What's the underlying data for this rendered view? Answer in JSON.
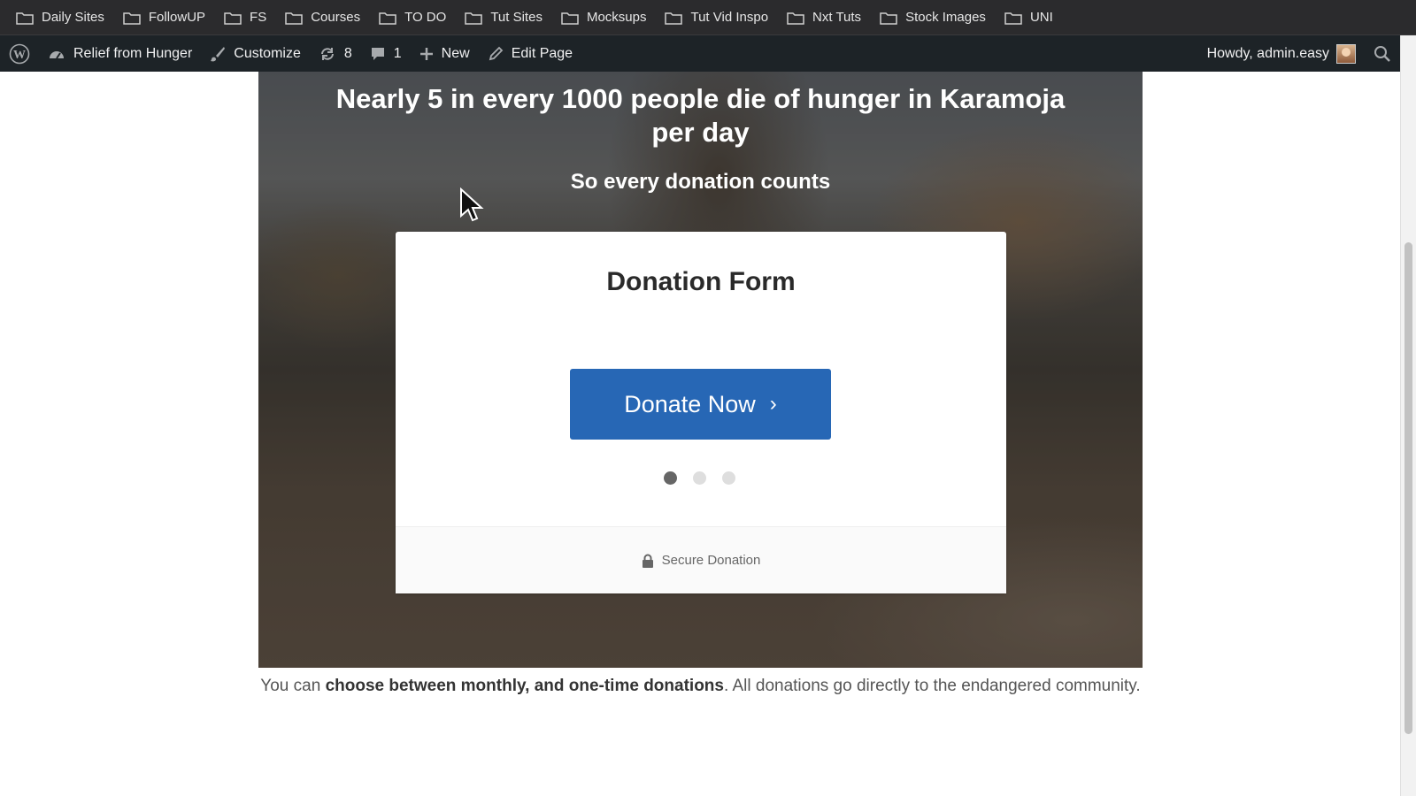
{
  "bookmarks": [
    "Daily Sites",
    "FollowUP",
    "FS",
    "Courses",
    "TO DO",
    "Tut Sites",
    "Mocksups",
    "Tut Vid Inspo",
    "Nxt Tuts",
    "Stock Images",
    "UNI"
  ],
  "adminbar": {
    "site_name": "Relief from Hunger",
    "customize": "Customize",
    "updates_count": "8",
    "comments_count": "1",
    "new_label": "New",
    "edit_label": "Edit Page",
    "howdy": "Howdy, admin.easy"
  },
  "hero": {
    "title": "Nearly 5 in every 1000 people die of hunger in Karamoja per day",
    "subtitle": "So every donation counts"
  },
  "form": {
    "title": "Donation Form",
    "button_label": "Donate Now",
    "button_chevron": "›",
    "active_step": 1,
    "step_count": 3,
    "footer": "Secure Donation"
  },
  "description": {
    "prefix": "You can ",
    "bold": "choose between monthly, and one-time donations",
    "suffix": ". All donations go directly to the endangered community."
  },
  "colors": {
    "button": "#2767b5",
    "adminbar": "#1d2327",
    "bookmarks_bar": "#2b2b2d"
  }
}
